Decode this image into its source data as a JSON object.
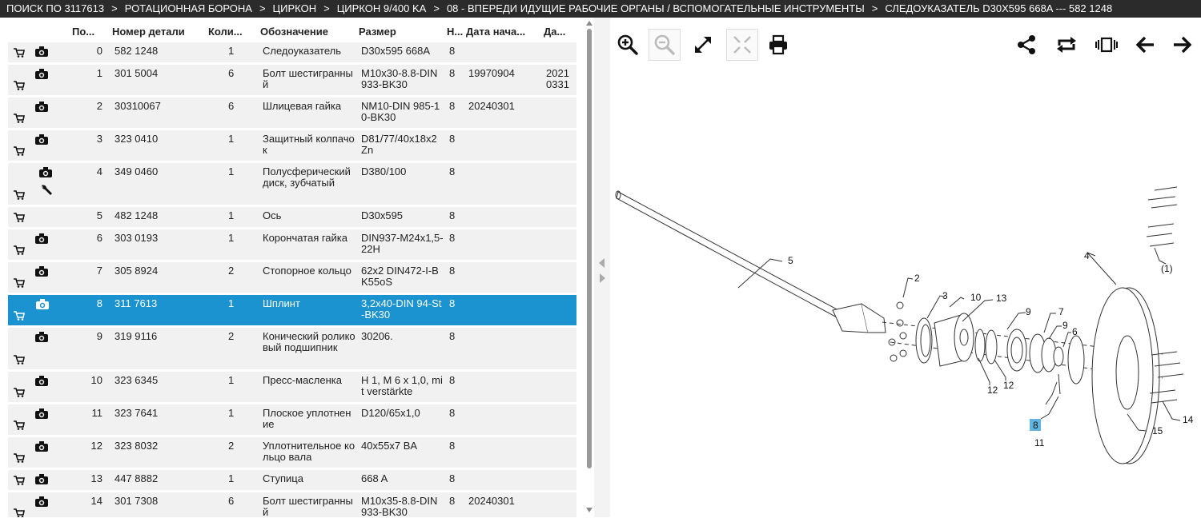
{
  "breadcrumb": [
    "ПОИСК ПО 3117613",
    "РОТАЦИОННАЯ БОРОНА",
    "ЦИРКОН",
    "ЦИРКОН 9/400 KA",
    "08 - ВПЕРЕДИ ИДУЩИЕ РАБОЧИЕ ОРГАНЫ / ВСПОМОГАТЕЛЬНЫЕ ИНСТРУМЕНТЫ",
    "СЛЕДОУКАЗАТЕЛЬ D30X595 668A --- 582 1248"
  ],
  "breadcrumb_sep": ">",
  "table": {
    "headers": [
      "По...",
      "Номер детали",
      "Коли...",
      "Обозначение",
      "Размер",
      "Н...",
      "Дата нача...",
      "Да..."
    ],
    "rows": [
      {
        "pos": "0",
        "num": "582 1248",
        "qty": "1",
        "name": "Следоуказатель",
        "size": "D30x595 668A",
        "n": "8",
        "date": "",
        "date2": "",
        "camera": true,
        "wrench": false,
        "selected": false,
        "h": 28
      },
      {
        "pos": "1",
        "num": "301 5004",
        "qty": "6",
        "name": "Болт шестигранный",
        "size": "M10x30-8.8-DIN 933-BK30",
        "n": "8",
        "date": "19970904",
        "date2": "20210331",
        "camera": true,
        "wrench": false,
        "selected": false,
        "h": 41
      },
      {
        "pos": "2",
        "num": "30310067",
        "qty": "6",
        "name": "Шлицевая гайка",
        "size": "NM10-DIN 985-10-BK30",
        "n": "8",
        "date": "20240301",
        "date2": "",
        "camera": true,
        "wrench": false,
        "selected": false,
        "h": 41
      },
      {
        "pos": "3",
        "num": "323 0410",
        "qty": "1",
        "name": "Защитный колпачок",
        "size": "D81/77/40x18x2 Zn",
        "n": "8",
        "date": "",
        "date2": "",
        "camera": true,
        "wrench": false,
        "selected": false,
        "h": 41
      },
      {
        "pos": "4",
        "num": "349 0460",
        "qty": "1",
        "name": "Полусферический диск, зубчатый",
        "size": "D380/100",
        "n": "8",
        "date": "",
        "date2": "",
        "camera": true,
        "wrench": true,
        "selected": false,
        "h": 55
      },
      {
        "pos": "5",
        "num": "482 1248",
        "qty": "1",
        "name": "Ось",
        "size": "D30x595",
        "n": "8",
        "date": "",
        "date2": "",
        "camera": false,
        "wrench": false,
        "selected": false,
        "h": 28
      },
      {
        "pos": "6",
        "num": "303 0193",
        "qty": "1",
        "name": "Корончатая гайка",
        "size": "DIN937-M24x1,5-22H",
        "n": "8",
        "date": "",
        "date2": "",
        "camera": true,
        "wrench": false,
        "selected": false,
        "h": 41
      },
      {
        "pos": "7",
        "num": "305 8924",
        "qty": "2",
        "name": "Стопорное кольцо",
        "size": "62x2 DIN472-I-BK55oS",
        "n": "8",
        "date": "",
        "date2": "",
        "camera": true,
        "wrench": false,
        "selected": false,
        "h": 41
      },
      {
        "pos": "8",
        "num": "311 7613",
        "qty": "1",
        "name": "Шплинт",
        "size": "3,2x40-DIN 94-St-BK30",
        "n": "8",
        "date": "",
        "date2": "",
        "camera": true,
        "wrench": false,
        "selected": true,
        "h": 41
      },
      {
        "pos": "9",
        "num": "319 9116",
        "qty": "2",
        "name": "Конический роликовый подшипник",
        "size": "30206.",
        "n": "8",
        "date": "",
        "date2": "",
        "camera": true,
        "wrench": false,
        "selected": false,
        "h": 55
      },
      {
        "pos": "10",
        "num": "323 6345",
        "qty": "1",
        "name": "Пресс-масленка",
        "size": "H 1, M 6 x 1,0, mit verstärkte",
        "n": "8",
        "date": "",
        "date2": "",
        "camera": true,
        "wrench": false,
        "selected": false,
        "h": 41
      },
      {
        "pos": "11",
        "num": "323 7641",
        "qty": "1",
        "name": "Плоское уплотнение",
        "size": "D120/65x1,0",
        "n": "8",
        "date": "",
        "date2": "",
        "camera": true,
        "wrench": false,
        "selected": false,
        "h": 41
      },
      {
        "pos": "12",
        "num": "323 8032",
        "qty": "2",
        "name": "Уплотнительное кольцо вала",
        "size": "40x55x7 BA",
        "n": "8",
        "date": "",
        "date2": "",
        "camera": true,
        "wrench": false,
        "selected": false,
        "h": 41
      },
      {
        "pos": "13",
        "num": "447 8882",
        "qty": "1",
        "name": "Ступица",
        "size": "668 A",
        "n": "8",
        "date": "",
        "date2": "",
        "camera": true,
        "wrench": false,
        "selected": false,
        "h": 28
      },
      {
        "pos": "14",
        "num": "301 7308",
        "qty": "6",
        "name": "Болт шестигранный",
        "size": "M10x35-8.8-DIN 933-BK30",
        "n": "8",
        "date": "20240301",
        "date2": "",
        "camera": true,
        "wrench": false,
        "selected": false,
        "h": 41
      }
    ]
  },
  "toolbar": {
    "left": [
      "zoom-in-icon",
      "zoom-out-icon",
      "expand-icon",
      "fit-icon",
      "print-icon"
    ],
    "right": [
      "share-icon",
      "repeat-icon",
      "carousel-icon",
      "arrow-left-icon",
      "arrow-right-icon"
    ]
  },
  "drawing": {
    "callouts": [
      "5",
      "4",
      "(1)",
      "2",
      "3",
      "10",
      "13",
      "9",
      "7",
      "9",
      "6",
      "12",
      "12",
      "8",
      "11",
      "15",
      "14"
    ],
    "highlight": "8"
  },
  "colors": {
    "selected_row": "#1a93d0",
    "row_bg": "#f1f1f1",
    "topbar": "#2b2b2b"
  }
}
